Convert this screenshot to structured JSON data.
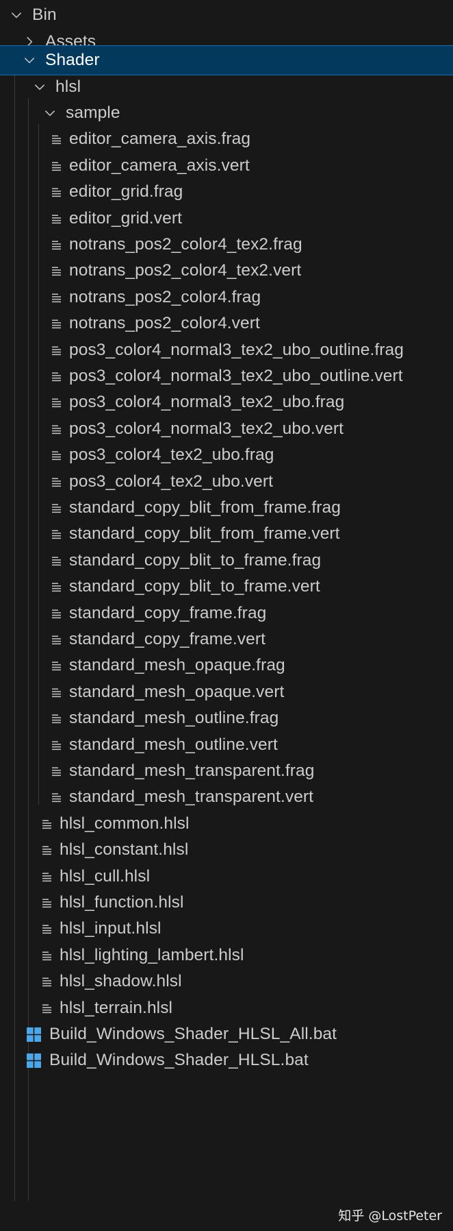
{
  "explorer": {
    "rows": [
      {
        "label": "Bin",
        "kind": "folder",
        "expanded": true,
        "depth": 0
      },
      {
        "label": "Assets",
        "kind": "folder",
        "expanded": false,
        "depth": 1
      },
      {
        "label": "Shader",
        "kind": "folder",
        "expanded": true,
        "depth": 1,
        "selected": true
      },
      {
        "label": "hlsl",
        "kind": "folder",
        "expanded": true,
        "depth": 2
      },
      {
        "label": "sample",
        "kind": "folder",
        "expanded": true,
        "depth": 3
      },
      {
        "label": "editor_camera_axis.frag",
        "kind": "file",
        "depth": 4
      },
      {
        "label": "editor_camera_axis.vert",
        "kind": "file",
        "depth": 4
      },
      {
        "label": "editor_grid.frag",
        "kind": "file",
        "depth": 4
      },
      {
        "label": "editor_grid.vert",
        "kind": "file",
        "depth": 4
      },
      {
        "label": "notrans_pos2_color4_tex2.frag",
        "kind": "file",
        "depth": 4
      },
      {
        "label": "notrans_pos2_color4_tex2.vert",
        "kind": "file",
        "depth": 4
      },
      {
        "label": "notrans_pos2_color4.frag",
        "kind": "file",
        "depth": 4
      },
      {
        "label": "notrans_pos2_color4.vert",
        "kind": "file",
        "depth": 4
      },
      {
        "label": "pos3_color4_normal3_tex2_ubo_outline.frag",
        "kind": "file",
        "depth": 4
      },
      {
        "label": "pos3_color4_normal3_tex2_ubo_outline.vert",
        "kind": "file",
        "depth": 4
      },
      {
        "label": "pos3_color4_normal3_tex2_ubo.frag",
        "kind": "file",
        "depth": 4
      },
      {
        "label": "pos3_color4_normal3_tex2_ubo.vert",
        "kind": "file",
        "depth": 4
      },
      {
        "label": "pos3_color4_tex2_ubo.frag",
        "kind": "file",
        "depth": 4
      },
      {
        "label": "pos3_color4_tex2_ubo.vert",
        "kind": "file",
        "depth": 4
      },
      {
        "label": "standard_copy_blit_from_frame.frag",
        "kind": "file",
        "depth": 4
      },
      {
        "label": "standard_copy_blit_from_frame.vert",
        "kind": "file",
        "depth": 4
      },
      {
        "label": "standard_copy_blit_to_frame.frag",
        "kind": "file",
        "depth": 4
      },
      {
        "label": "standard_copy_blit_to_frame.vert",
        "kind": "file",
        "depth": 4
      },
      {
        "label": "standard_copy_frame.frag",
        "kind": "file",
        "depth": 4
      },
      {
        "label": "standard_copy_frame.vert",
        "kind": "file",
        "depth": 4
      },
      {
        "label": "standard_mesh_opaque.frag",
        "kind": "file",
        "depth": 4
      },
      {
        "label": "standard_mesh_opaque.vert",
        "kind": "file",
        "depth": 4
      },
      {
        "label": "standard_mesh_outline.frag",
        "kind": "file",
        "depth": 4
      },
      {
        "label": "standard_mesh_outline.vert",
        "kind": "file",
        "depth": 4
      },
      {
        "label": "standard_mesh_transparent.frag",
        "kind": "file",
        "depth": 4
      },
      {
        "label": "standard_mesh_transparent.vert",
        "kind": "file",
        "depth": 4
      },
      {
        "label": "hlsl_common.hlsl",
        "kind": "file",
        "depth": 3
      },
      {
        "label": "hlsl_constant.hlsl",
        "kind": "file",
        "depth": 3
      },
      {
        "label": "hlsl_cull.hlsl",
        "kind": "file",
        "depth": 3
      },
      {
        "label": "hlsl_function.hlsl",
        "kind": "file",
        "depth": 3
      },
      {
        "label": "hlsl_input.hlsl",
        "kind": "file",
        "depth": 3
      },
      {
        "label": "hlsl_lighting_lambert.hlsl",
        "kind": "file",
        "depth": 3
      },
      {
        "label": "hlsl_shadow.hlsl",
        "kind": "file",
        "depth": 3
      },
      {
        "label": "hlsl_terrain.hlsl",
        "kind": "file",
        "depth": 3
      },
      {
        "label": "Build_Windows_Shader_HLSL_All.bat",
        "kind": "bat",
        "depth": 2
      },
      {
        "label": "Build_Windows_Shader_HLSL.bat",
        "kind": "bat",
        "depth": 2
      }
    ]
  },
  "watermark": {
    "text": "知乎 @LostPeter"
  },
  "colors": {
    "background": "#181818",
    "text": "#cccccc",
    "selected_background": "#04395e",
    "selected_border": "#0b6fb8",
    "windows_icon": "#4aa8ea",
    "indent_guide": "#3a3a3a"
  }
}
